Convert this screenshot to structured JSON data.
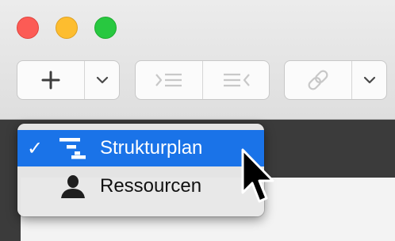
{
  "window": {
    "controls": [
      "close-icon",
      "minimize-icon",
      "maximize-icon"
    ]
  },
  "toolbar": {
    "add": {
      "icon": "plus-icon"
    },
    "add_menu": {
      "icon": "chevron-down-icon"
    },
    "indent": {
      "icon": "indent-icon"
    },
    "outdent": {
      "icon": "outdent-icon"
    },
    "link": {
      "icon": "link-icon"
    },
    "link_menu": {
      "icon": "chevron-down-icon"
    }
  },
  "view_menu": {
    "items": [
      {
        "label": "Strukturplan",
        "icon": "outline-structure-icon",
        "checked": true
      },
      {
        "label": "Ressourcen",
        "icon": "person-icon",
        "checked": false
      }
    ]
  },
  "colors": {
    "selection": "#1a73e8",
    "close": "#fc5b55",
    "minimize": "#fdbd2f",
    "maximize": "#28c840"
  }
}
